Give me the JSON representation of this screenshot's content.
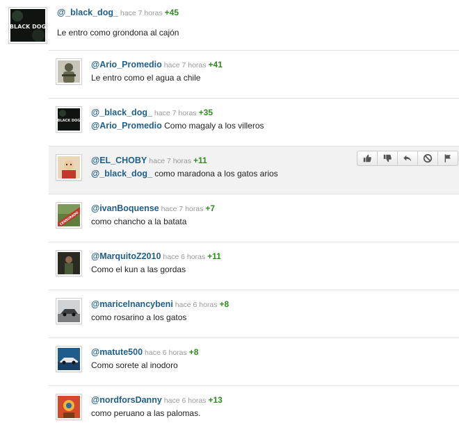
{
  "comments": [
    {
      "user": "@_black_dog_",
      "time": "hace 7 horas",
      "votes": "+45",
      "text": "Le entro como grondona al cajón"
    },
    {
      "user": "@Ario_Promedio",
      "time": "hace 7 horas",
      "votes": "+41",
      "text": "Le entro como el agua a chile"
    },
    {
      "user": "@_black_dog_",
      "time": "hace 7 horas",
      "votes": "+35",
      "mention": "@Ario_Promedio",
      "text": " Como magaly a los villeros"
    },
    {
      "user": "@EL_CHOBY",
      "time": "hace 7 horas",
      "votes": "+11",
      "mention": "@_black_dog_",
      "text": " como maradona a los gatos arios"
    },
    {
      "user": "@ivanBoquense",
      "time": "hace 7 horas",
      "votes": "+7",
      "text": "como chancho a la batata"
    },
    {
      "user": "@MarquitoZ2010",
      "time": "hace 6 horas",
      "votes": "+11",
      "text": "Como el kun a las gordas"
    },
    {
      "user": "@maricelnancybeni",
      "time": "hace 6 horas",
      "votes": "+8",
      "text": "como rosarino a los gatos"
    },
    {
      "user": "@matute500",
      "time": "hace 6 horas",
      "votes": "+8",
      "text": "Como sorete al inodoro"
    },
    {
      "user": "@nordforsDanny",
      "time": "hace 6 horas",
      "votes": "+13",
      "text": "como peruano a las palomas."
    }
  ],
  "avatars": {
    "black_dog_label": "BLACK DOG",
    "censored_label": "CENSURADO"
  },
  "actions": [
    "thumbs-up-icon",
    "thumbs-down-icon",
    "reply-icon",
    "block-icon",
    "flag-icon"
  ]
}
